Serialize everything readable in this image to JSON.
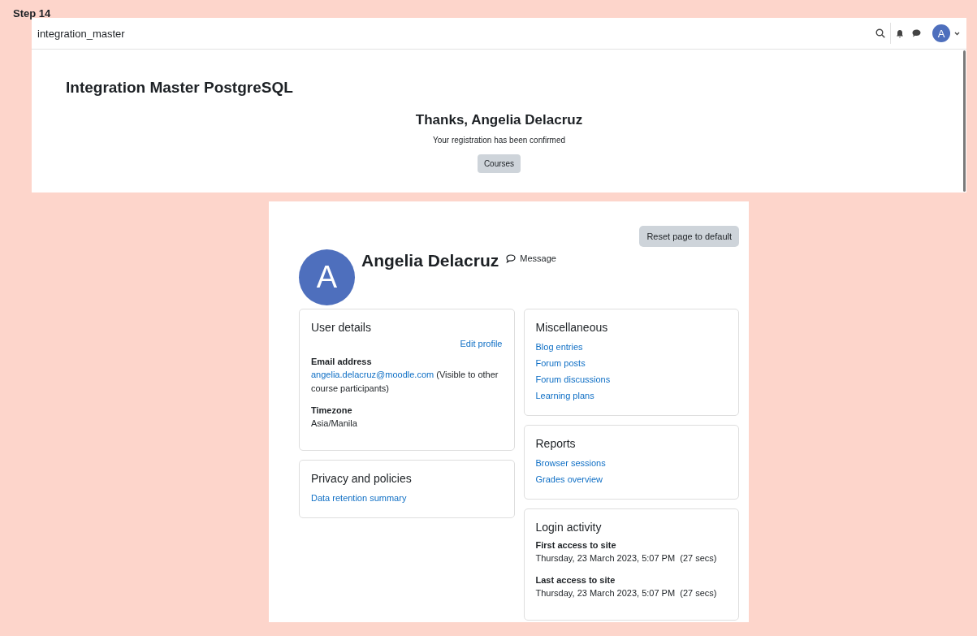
{
  "step_label": "Step 14",
  "top_window": {
    "navbar": {
      "site_name": "integration_master",
      "avatar_letter": "A"
    },
    "page_title": "Integration Master PostgreSQL",
    "heading": "Thanks, Angelia Delacruz",
    "message": "Your registration has been confirmed",
    "button": "Courses"
  },
  "profile": {
    "reset_button": "Reset page to default",
    "avatar_letter": "A",
    "name": "Angelia Delacruz",
    "message_link": "Message",
    "left_cards": [
      {
        "title": "User details",
        "edit_link": "Edit profile",
        "fields": [
          {
            "kind": "email",
            "label": "Email address",
            "link": "angelia.delacruz@moodle.com",
            "note": "(Visible to other course participants)"
          },
          {
            "kind": "text",
            "label": "Timezone",
            "value": "Asia/Manila"
          }
        ]
      },
      {
        "title": "Privacy and policies",
        "links": [
          "Data retention summary"
        ]
      }
    ],
    "right_cards": [
      {
        "title": "Miscellaneous",
        "links": [
          "Blog entries",
          "Forum posts",
          "Forum discussions",
          "Learning plans"
        ]
      },
      {
        "title": "Reports",
        "links": [
          "Browser sessions",
          "Grades overview"
        ]
      },
      {
        "title": "Login activity",
        "fields": [
          {
            "kind": "text",
            "label": "First access to site",
            "value": "Thursday, 23 March 2023, 5:07 PM  (27 secs)"
          },
          {
            "kind": "text",
            "label": "Last access to site",
            "value": "Thursday, 23 March 2023, 5:07 PM  (27 secs)"
          }
        ]
      }
    ]
  }
}
